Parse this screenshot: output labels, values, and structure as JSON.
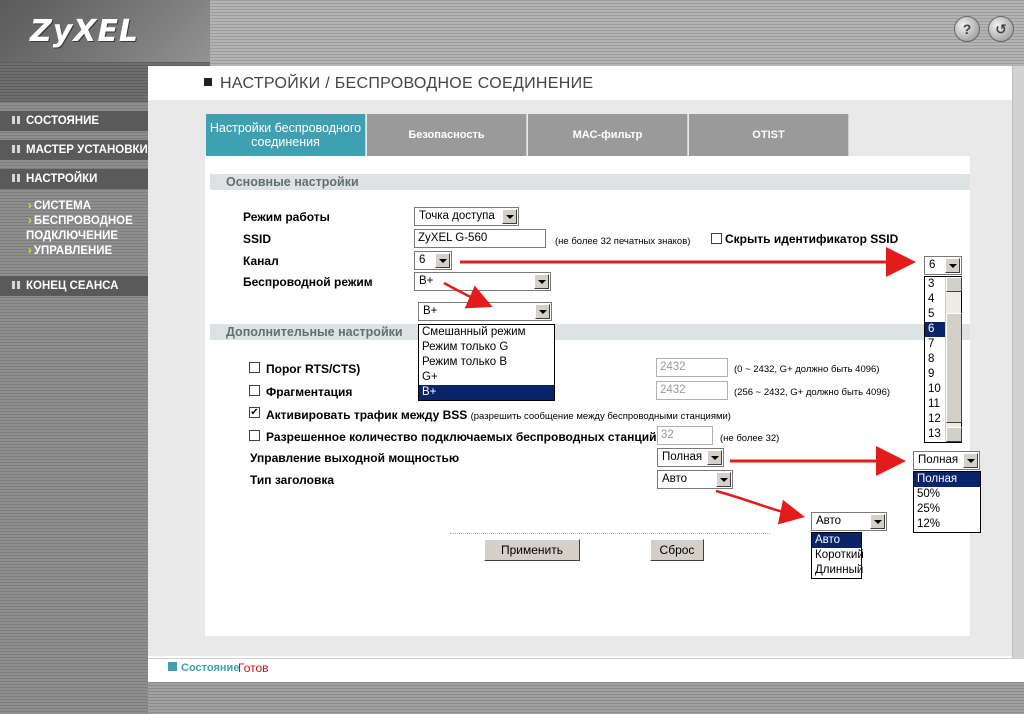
{
  "brand": "ZyXEL",
  "top_icons": {
    "help": "?",
    "logout": "↺"
  },
  "sidebar": {
    "items": [
      {
        "label": "СОСТОЯНИЕ"
      },
      {
        "label": "МАСТЕР УСТАНОВКИ"
      },
      {
        "label": "НАСТРОЙКИ"
      },
      {
        "label": "КОНЕЦ СЕАНСА"
      }
    ],
    "sub_items": [
      "СИСТЕМА",
      "БЕСПРОВОДНОЕ",
      "ПОДКЛЮЧЕНИЕ",
      "УПРАВЛЕНИЕ"
    ]
  },
  "page_title": "НАСТРОЙКИ / БЕСПРОВОДНОЕ СОЕДИНЕНИЕ",
  "tabs": [
    {
      "label": "Настройки беспроводного соединения",
      "active": true
    },
    {
      "label": "Безопасность"
    },
    {
      "label": "МАС-фильтр"
    },
    {
      "label": "OTIST"
    }
  ],
  "basic": {
    "title": "Основные настройки",
    "mode_label": "Режим работы",
    "mode_value": "Точка доступа",
    "ssid_label": "SSID",
    "ssid_value": "ZyXEL G-560",
    "ssid_hint": "(не более 32 печатных знаков)",
    "hide_ssid_label": "Скрыть идентификатор SSID",
    "channel_label": "Канал",
    "channel_value": "6",
    "wireless_mode_label": "Беспроводной режим",
    "wireless_mode_value": "B+"
  },
  "wireless_mode_dropdown": {
    "selected": "B+",
    "options": [
      "Смешанный режим",
      "Режим только G",
      "Режим только B",
      "G+",
      "B+"
    ]
  },
  "channel_dropdown": {
    "selected": "6",
    "options": [
      "3",
      "4",
      "5",
      "6",
      "7",
      "8",
      "9",
      "10",
      "11",
      "12",
      "13"
    ]
  },
  "advanced": {
    "title": "Дополнительные настройки",
    "rts_label": "Порог RTS/CTS)",
    "rts_value": "2432",
    "rts_hint": "(0 ~ 2432, G+ должно быть 4096)",
    "frag_label": "Фрагментация",
    "frag_value": "2432",
    "frag_hint": "(256 ~ 2432, G+ должно быть 4096)",
    "bss_label": "Активировать трафик между BSS",
    "bss_hint": "(разрешить сообщение между беспроводными станциями)",
    "max_clients_label": "Разрешенное количество подключаемых беспроводных станций:",
    "max_clients_value": "32",
    "max_clients_hint": "(не более 32)",
    "power_label": "Управление выходной мощностью",
    "power_value": "Полная",
    "preamble_label": "Тип заголовка",
    "preamble_value": "Авто"
  },
  "power_dropdown": {
    "selected": "Полная",
    "options": [
      "Полная",
      "50%",
      "25%",
      "12%"
    ]
  },
  "preamble_dropdown": {
    "selected": "Авто",
    "options": [
      "Авто",
      "Короткий",
      "Длинный"
    ]
  },
  "buttons": {
    "apply": "Применить",
    "reset": "Сброс"
  },
  "status": {
    "label": "Состояние",
    "value": "Готов"
  },
  "colors": {
    "accent": "#3fa0b2",
    "arrow": "#e21b1b",
    "selection": "#0a246a"
  }
}
